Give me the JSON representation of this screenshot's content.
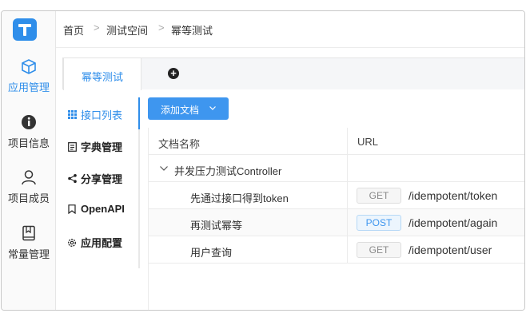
{
  "sidebar": {
    "items": [
      {
        "label": "应用管理",
        "icon": "app-box-icon",
        "active": true
      },
      {
        "label": "项目信息",
        "icon": "info-icon",
        "active": false
      },
      {
        "label": "项目成员",
        "icon": "user-icon",
        "active": false
      },
      {
        "label": "常量管理",
        "icon": "book-icon",
        "active": false
      }
    ]
  },
  "breadcrumb": {
    "items": [
      "首页",
      "测试空间",
      "幂等测试"
    ],
    "separator": ">"
  },
  "tabs": {
    "active_label": "幂等测试",
    "add_icon": "plus-circle-icon"
  },
  "doc_nav": {
    "items": [
      {
        "label": "接口列表",
        "icon": "grid-icon"
      },
      {
        "label": "字典管理",
        "icon": "doc-icon"
      },
      {
        "label": "分享管理",
        "icon": "share-icon"
      },
      {
        "label": "OpenAPI",
        "icon": "bookmark-icon"
      },
      {
        "label": "应用配置",
        "icon": "gear-icon"
      }
    ]
  },
  "toolbar": {
    "add_doc_label": "添加文档"
  },
  "table": {
    "headers": {
      "name": "文档名称",
      "url": "URL"
    },
    "group": {
      "label": "并发压力测试Controller"
    },
    "rows": [
      {
        "name": "先通过接口得到token",
        "method": "GET",
        "path": "/idempotent/token"
      },
      {
        "name": "再测试幂等",
        "method": "POST",
        "path": "/idempotent/again"
      },
      {
        "name": "用户查询",
        "method": "GET",
        "path": "/idempotent/user"
      }
    ]
  },
  "colors": {
    "accent": "#2f8eea",
    "button": "#3e96ef"
  }
}
